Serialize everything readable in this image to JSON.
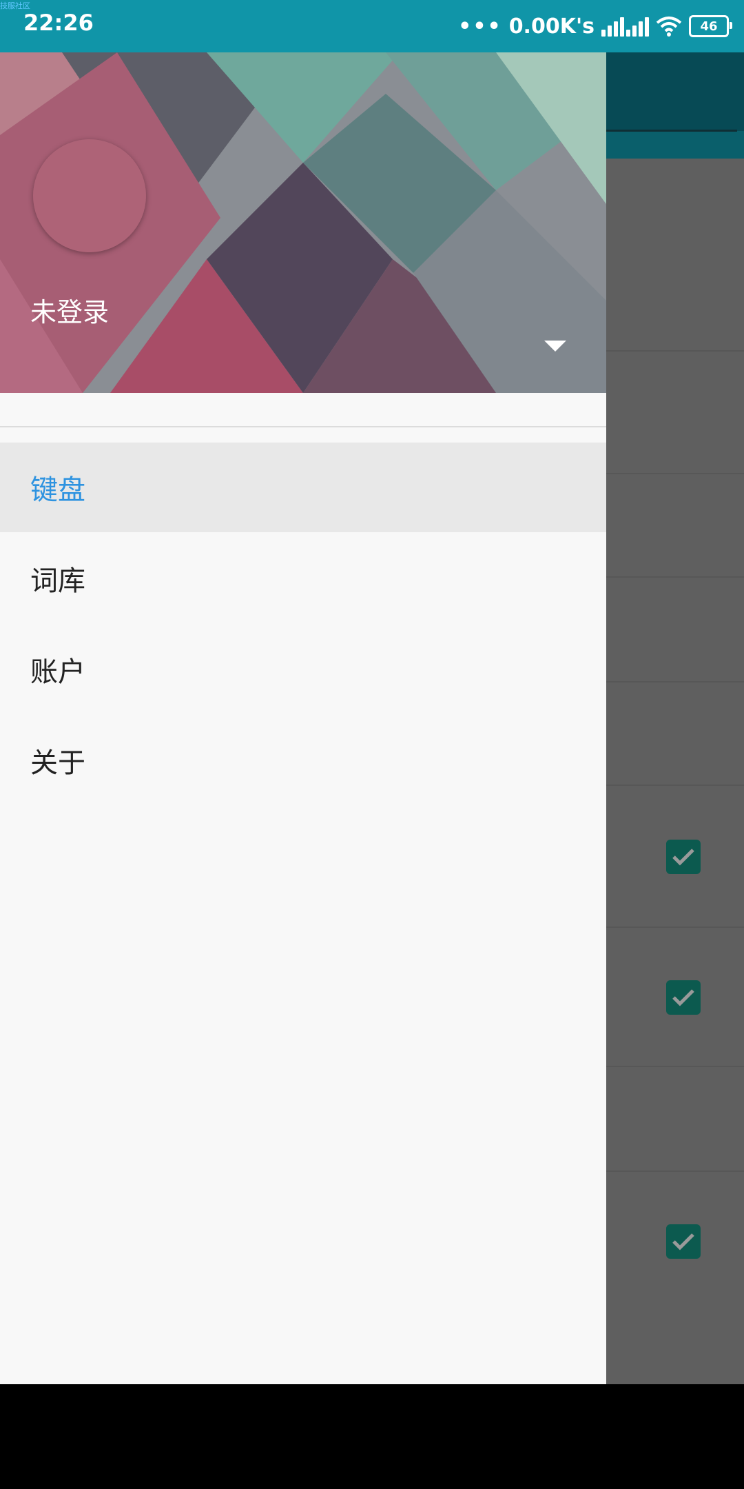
{
  "status_bar": {
    "corner_tag": "技服社区",
    "time": "22:26",
    "network_speed": "0.00K's",
    "battery": "46",
    "icons": [
      "more-dots-icon",
      "signal-icon",
      "wifi-icon",
      "battery-icon"
    ]
  },
  "drawer": {
    "header": {
      "user_name": "未登录",
      "dropdown_icon": "caret-down-icon"
    },
    "menu": [
      {
        "label": "键盘",
        "active": true
      },
      {
        "label": "词库",
        "active": false
      },
      {
        "label": "账户",
        "active": false
      },
      {
        "label": "关于",
        "active": false
      }
    ]
  },
  "colors": {
    "status_bar": "#1095a8",
    "active_item_text": "#2e93e0",
    "active_item_bg": "#e8e8e8",
    "drawer_bg": "#f8f8f8",
    "scrim": "#5f5f5f",
    "checkbox": "#0c5a4f"
  },
  "background_app": {
    "checkboxes_checked": [
      true,
      true,
      true
    ]
  }
}
